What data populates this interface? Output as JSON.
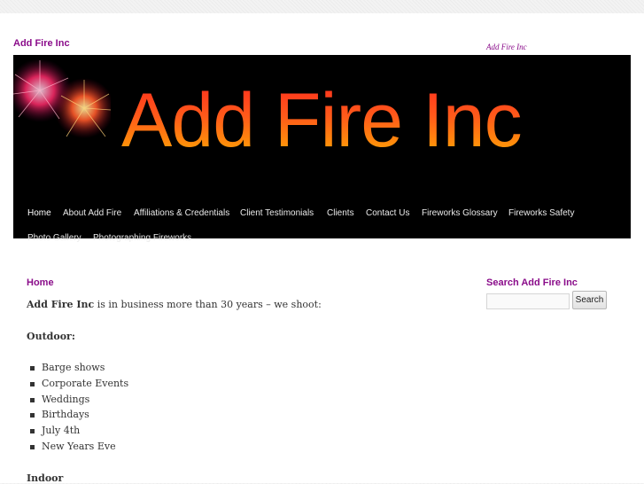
{
  "site": {
    "title": "Add Fire Inc",
    "description": "Add Fire Inc",
    "banner_text": "Add Fire Inc"
  },
  "nav": {
    "items": [
      {
        "label": "Home",
        "current": true
      },
      {
        "label": "About Add Fire"
      },
      {
        "label": "Affiliations & Credentials"
      },
      {
        "label": "Client Testimonials"
      },
      {
        "label": "Clients"
      },
      {
        "label": "Contact Us"
      },
      {
        "label": "Fireworks Glossary"
      },
      {
        "label": "Fireworks Safety"
      },
      {
        "label": "Photo Gallery"
      },
      {
        "label": "Photographing Fireworks"
      }
    ]
  },
  "content": {
    "page_title": "Home",
    "intro_bold": "Add Fire Inc",
    "intro_rest": " is in business more than 30 years – we shoot:",
    "outdoor_heading": "Outdoor:",
    "outdoor_items": [
      "Barge shows",
      "Corporate Events",
      "Weddings",
      "Birthdays",
      "July 4th",
      "New Years Eve"
    ],
    "indoor_heading": "Indoor"
  },
  "sidebar": {
    "search_title": "Search Add Fire Inc",
    "search_value": "",
    "search_button": "Search"
  },
  "colors": {
    "accent": "#8a0c8a",
    "banner_bg": "#000000",
    "nav_text": "#eaeaea"
  }
}
